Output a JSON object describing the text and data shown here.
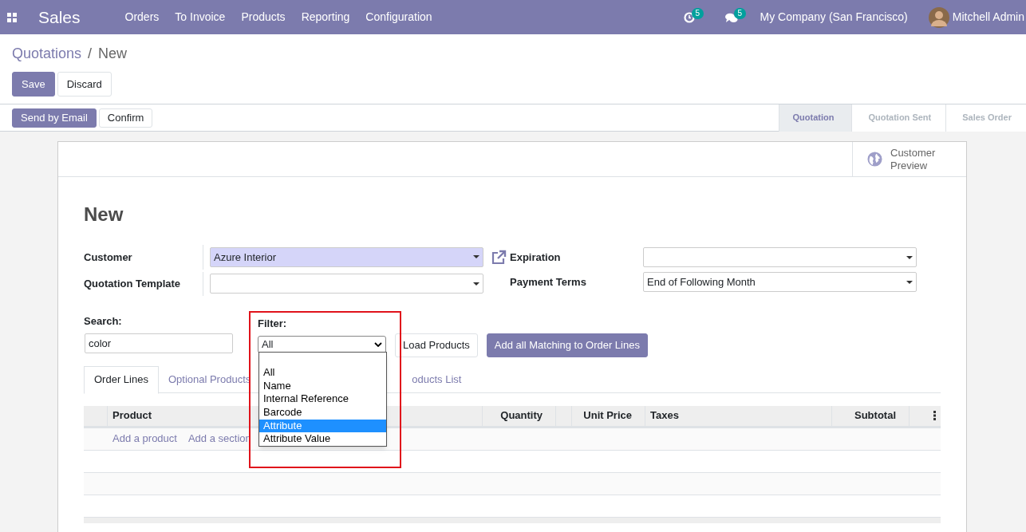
{
  "navbar": {
    "app": "Sales",
    "menu": [
      "Orders",
      "To Invoice",
      "Products",
      "Reporting",
      "Configuration"
    ],
    "activity_count": "5",
    "message_count": "5",
    "company": "My Company (San Francisco)",
    "user": "Mitchell Admin"
  },
  "breadcrumb": {
    "parent": "Quotations",
    "separator": "/",
    "current": "New"
  },
  "actions": [
    {
      "label": "Save",
      "kind": "primary"
    },
    {
      "label": "Discard",
      "kind": "secondary"
    }
  ],
  "status_actions": [
    {
      "label": "Send by Email",
      "kind": "primary"
    },
    {
      "label": "Confirm",
      "kind": "secondary"
    }
  ],
  "stages": [
    {
      "label": "Quotation",
      "selected": true
    },
    {
      "label": "Quotation Sent",
      "selected": false
    },
    {
      "label": "Sales Order",
      "selected": false
    }
  ],
  "smart_button": {
    "label": "Customer Preview"
  },
  "title": "New",
  "fields_left": [
    {
      "label": "Customer",
      "value": "Azure Interior",
      "highlighted": true
    },
    {
      "label": "Quotation Template",
      "highlighted": false
    }
  ],
  "fields_right": [
    {
      "label": "Expiration"
    },
    {
      "label": "Payment Terms",
      "value": "End of Following Month"
    }
  ],
  "search": {
    "label": "Search:",
    "value": "color"
  },
  "filter": {
    "label": "Filter:",
    "value": "All",
    "options": [
      {
        "label": "All",
        "highlighted": false
      },
      {
        "label": "Name",
        "highlighted": false
      },
      {
        "label": "Internal Reference",
        "highlighted": false
      },
      {
        "label": "Barcode",
        "highlighted": false
      },
      {
        "label": "Attribute",
        "highlighted": true
      },
      {
        "label": "Attribute Value",
        "highlighted": false
      }
    ]
  },
  "load_buttons": [
    {
      "label": "Load Products",
      "kind": "secondary"
    },
    {
      "label": "Add all Matching to Order Lines",
      "kind": "primary"
    }
  ],
  "tabs": [
    {
      "label": "Order Lines",
      "selected": true
    },
    {
      "label": "Optional Products",
      "selected": false
    },
    {
      "label": "oducts List",
      "selected": false
    }
  ],
  "table": {
    "columns": [
      {
        "label": "Product",
        "kind": "left"
      },
      {
        "label": "Quantity",
        "kind": "right"
      },
      {
        "label": "Unit Price",
        "kind": "right"
      },
      {
        "label": "Taxes",
        "kind": "left"
      },
      {
        "label": "Subtotal",
        "kind": "right"
      }
    ],
    "add_links": [
      "Add a product",
      "Add a section"
    ]
  }
}
